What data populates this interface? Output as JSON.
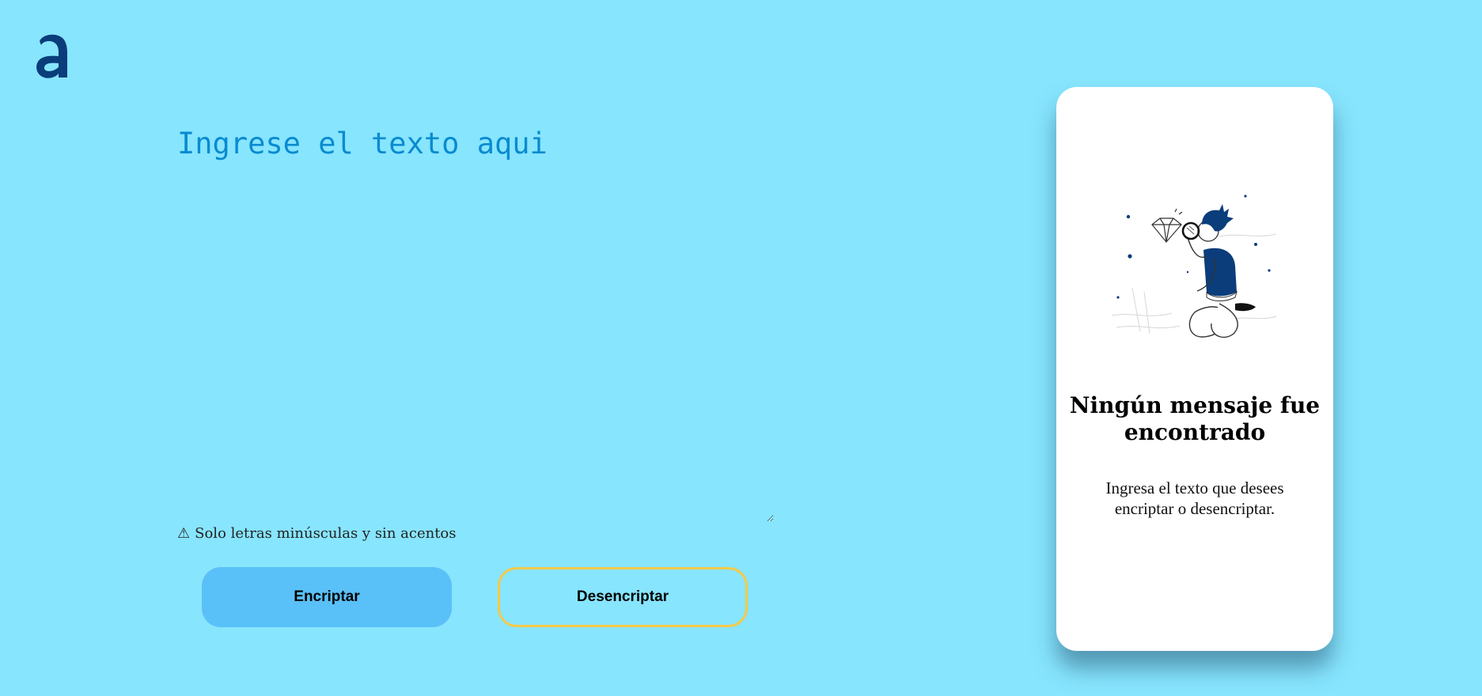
{
  "logo": {
    "icon": "alura-a-logo",
    "color": "#0a3d7a"
  },
  "input": {
    "placeholder": "Ingrese el texto aqui",
    "value": ""
  },
  "warning": {
    "icon": "warning-triangle-icon",
    "symbol": "⚠",
    "text": "Solo letras minúsculas y sin acentos"
  },
  "buttons": {
    "encrypt_label": "Encriptar",
    "decrypt_label": "Desencriptar"
  },
  "output_panel": {
    "illustration": "person-with-magnifying-glass-illustration",
    "title": "Ningún mensaje fue encontrado",
    "description": "Ingresa el texto que desees encriptar o desencriptar."
  },
  "colors": {
    "background": "#87e5fe",
    "accent_text": "#0a8bd0",
    "encrypt_button": "#5ac0f8",
    "decrypt_border": "#f5c94a",
    "brand_dark": "#0a3d7a"
  }
}
